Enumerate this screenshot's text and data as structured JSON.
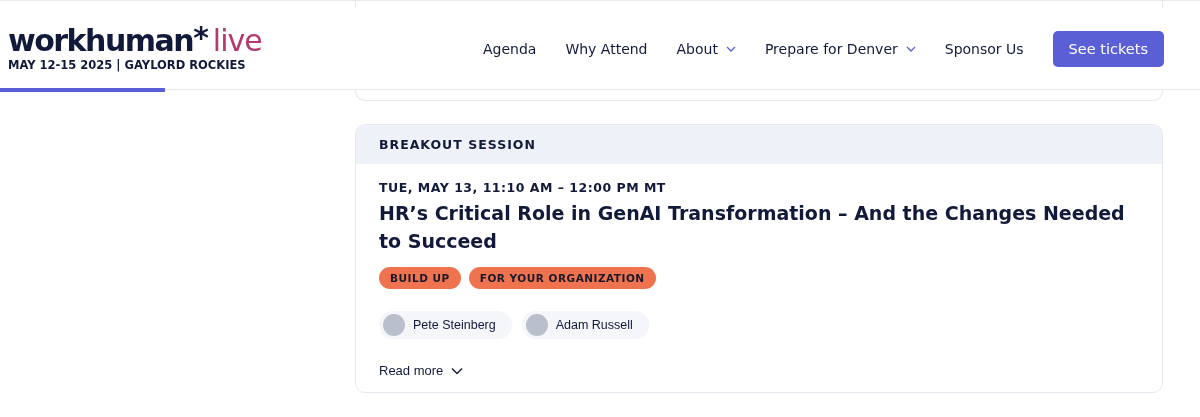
{
  "header": {
    "logo": {
      "word": "workhuman",
      "mark": "*",
      "accent": "live",
      "tagline": "MAY 12-15 2025 | GAYLORD ROCKIES"
    },
    "progress": {
      "level": 0.1375
    },
    "nav": [
      {
        "label": "Agenda",
        "dropdown": false
      },
      {
        "label": "Why Attend",
        "dropdown": false
      },
      {
        "label": "About",
        "dropdown": true
      },
      {
        "label": "Prepare for Denver",
        "dropdown": true
      },
      {
        "label": "Sponsor Us",
        "dropdown": false
      }
    ],
    "cta": "See tickets"
  },
  "session": {
    "type": "BREAKOUT SESSION",
    "time": "TUE, MAY 13, 11:10 AM – 12:00 PM MT",
    "title": "HR’s Critical Role in GenAI Transformation – And the Changes Needed to Succeed",
    "tags": [
      {
        "label": "BUILD UP",
        "color": "#f07350"
      },
      {
        "label": "FOR YOUR ORGANIZATION",
        "color": "#f07350"
      }
    ],
    "speakers": [
      "Pete Steinberg",
      "Adam Russell"
    ],
    "read_more": "Read more"
  }
}
